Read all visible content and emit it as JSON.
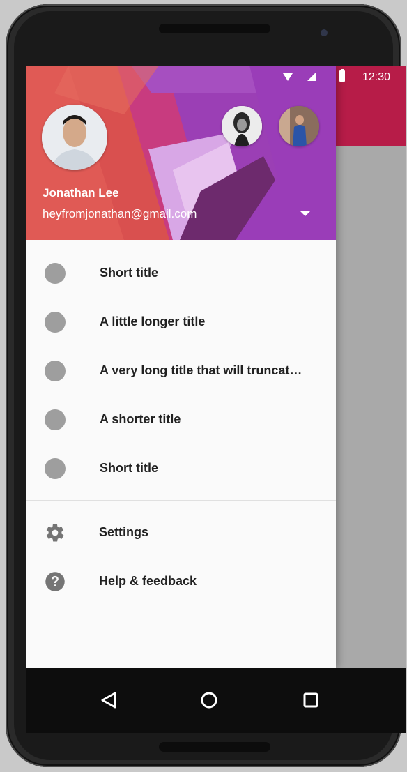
{
  "status_bar": {
    "time": "12:30"
  },
  "drawer": {
    "account": {
      "name": "Jonathan Lee",
      "email": "heyfromjonathan@gmail.com"
    },
    "items": [
      {
        "label": "Short title"
      },
      {
        "label": "A little longer title"
      },
      {
        "label": "A very long title that will truncat…"
      },
      {
        "label": "A shorter title"
      },
      {
        "label": "Short title"
      }
    ],
    "secondary": [
      {
        "label": "Settings",
        "icon": "gear-icon"
      },
      {
        "label": "Help & feedback",
        "icon": "help-icon"
      }
    ]
  },
  "colors": {
    "app_toolbar": "#b71c48",
    "drawer_header": "#a33fba",
    "nav_dot": "#9e9e9e",
    "text_primary": "#212121"
  }
}
